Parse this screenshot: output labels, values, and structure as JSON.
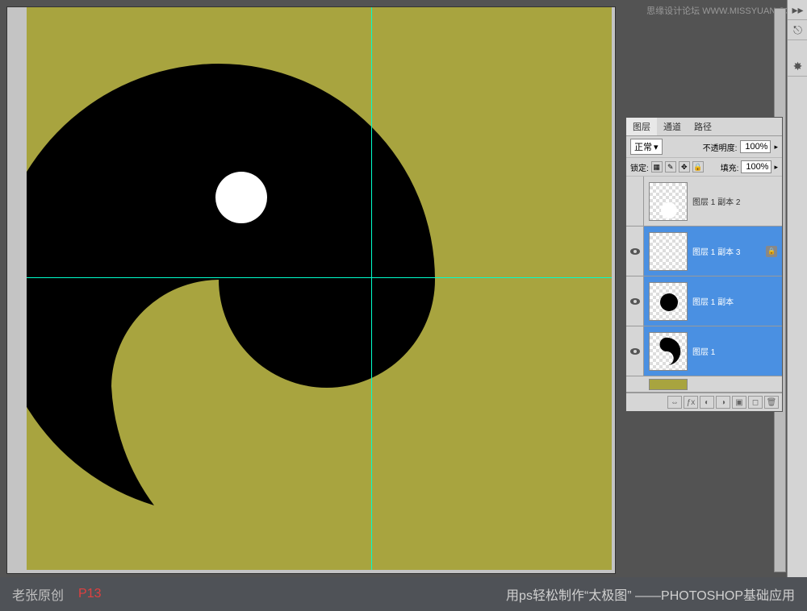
{
  "watermark": "思缘设计论坛 WWW.MISSYUAN.COM",
  "panel": {
    "tabs": {
      "layers": "图层",
      "channels": "通道",
      "paths": "路径"
    },
    "blend_label": "正常",
    "opacity_label": "不透明度:",
    "opacity_value": "100%",
    "fill_label": "填充:",
    "fill_value": "100%",
    "lock_label": "锁定:"
  },
  "layers": [
    {
      "name": "图层 1 副本 2",
      "selected": false,
      "visible": false,
      "thumb": "white-circle"
    },
    {
      "name": "图层 1 副本 3",
      "selected": true,
      "visible": true,
      "thumb": "empty",
      "locked": true
    },
    {
      "name": "图层 1 副本",
      "selected": true,
      "visible": true,
      "thumb": "black-circle"
    },
    {
      "name": "图层 1",
      "selected": true,
      "visible": true,
      "thumb": "shape"
    }
  ],
  "footer": {
    "author": "老张原创",
    "page": "P13",
    "title": "用ps轻松制作“太极图” ——PHOTOSHOP基础应用"
  },
  "colors": {
    "canvas_bg": "#a8a43f",
    "guide": "#00ffcc",
    "selected_layer": "#4a90e2"
  }
}
